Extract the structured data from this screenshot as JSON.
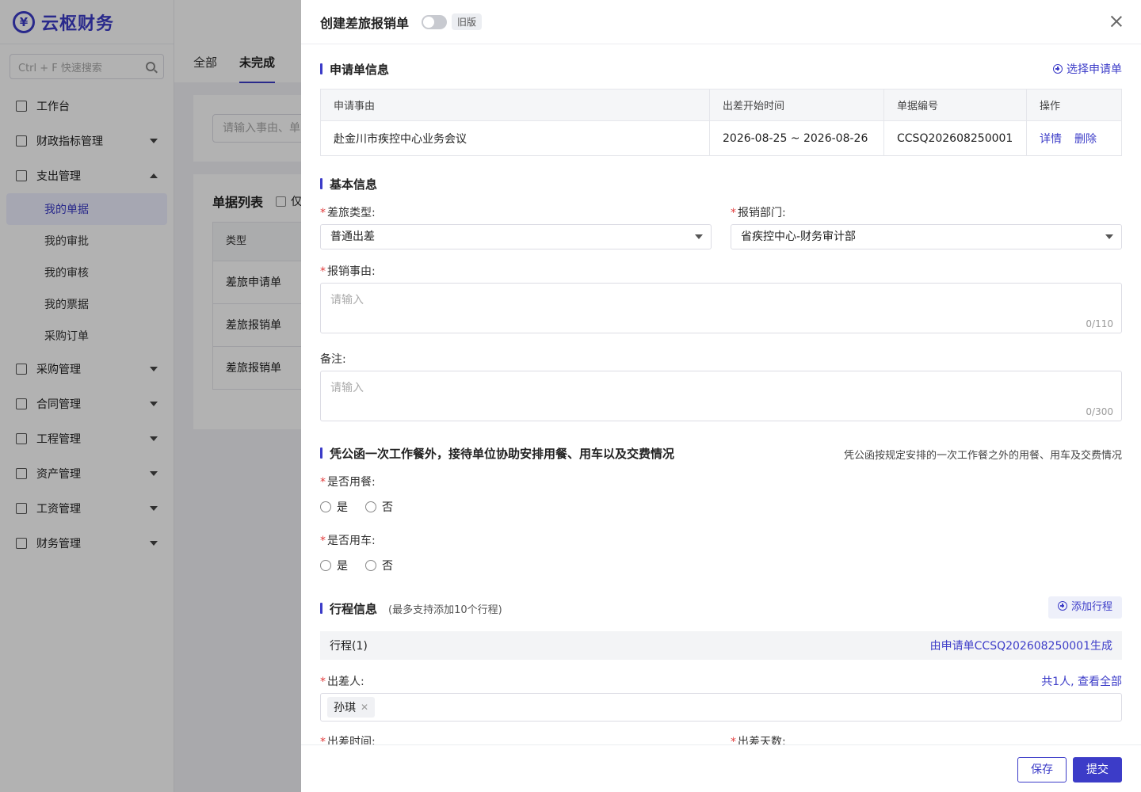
{
  "app": {
    "logo_text": "云枢财务"
  },
  "sidebar": {
    "search_placeholder": "Ctrl + F 快速搜索",
    "items": [
      {
        "label": "工作台"
      },
      {
        "label": "财政指标管理"
      },
      {
        "label": "支出管理"
      },
      {
        "label": "采购管理"
      },
      {
        "label": "合同管理"
      },
      {
        "label": "工程管理"
      },
      {
        "label": "资产管理"
      },
      {
        "label": "工资管理"
      },
      {
        "label": "财务管理"
      }
    ],
    "expense_sub": [
      "我的单据",
      "我的审批",
      "我的审核",
      "我的票据",
      "采购订单"
    ]
  },
  "main": {
    "tabs": [
      "全部",
      "未完成"
    ],
    "filter_placeholder": "请输入事由、单",
    "list_title": "单据列表",
    "only_label": "仅",
    "table_header": "类型",
    "rows": [
      "差旅申请单",
      "差旅报销单",
      "差旅报销单"
    ]
  },
  "drawer": {
    "title": "创建差旅报销单",
    "old_version": "旧版",
    "apply_section": {
      "title": "申请单信息",
      "select_link": "选择申请单",
      "headers": [
        "申请事由",
        "出差开始时间",
        "单据编号",
        "操作"
      ],
      "row": {
        "reason": "赴金川市疾控中心业务会议",
        "period": "2026-08-25 ~ 2026-08-26",
        "number": "CCSQ202608250001",
        "detail": "详情",
        "delete": "删除"
      }
    },
    "basic_section": {
      "title": "基本信息",
      "travel_type_label": "差旅类型:",
      "travel_type_value": "普通出差",
      "dept_label": "报销部门:",
      "dept_value": "省疾控中心-财务审计部",
      "reason_label": "报销事由:",
      "reason_placeholder": "请输入",
      "reason_count": "0/110",
      "remark_label": "备注:",
      "remark_placeholder": "请输入",
      "remark_count": "0/300"
    },
    "reception_section": {
      "title": "凭公函一次工作餐外，接待单位协助安排用餐、用车以及交费情况",
      "note": "凭公函按规定安排的一次工作餐之外的用餐、用车及交费情况",
      "meal_label": "是否用餐:",
      "car_label": "是否用车:",
      "yes": "是",
      "no": "否"
    },
    "trip_section": {
      "title": "行程信息",
      "hint": "(最多支持添加10个行程)",
      "add_button": "添加行程",
      "trip_name": "行程(1)",
      "trip_source": "由申请单CCSQ202608250001生成",
      "traveler_label": "出差人:",
      "traveler_summary": "共1人, 查看全部",
      "traveler_chip": "孙琪",
      "time_label": "出差时间:",
      "days_label": "出差天数:"
    },
    "footer": {
      "save": "保存",
      "submit": "提交"
    }
  },
  "colors": {
    "primary": "#3c3cc8",
    "required": "#e23c3c"
  }
}
